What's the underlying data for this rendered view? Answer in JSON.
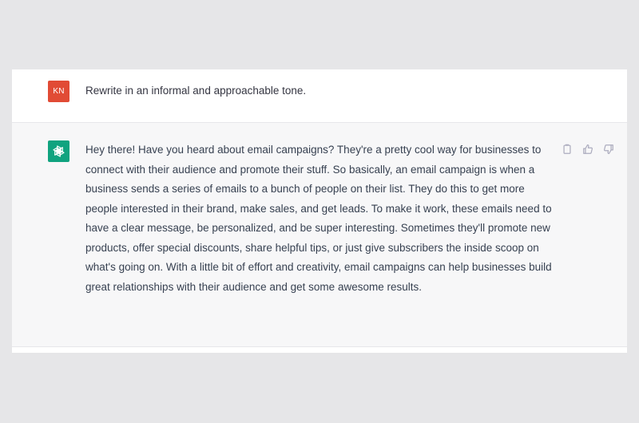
{
  "conversation": {
    "user_message": {
      "avatar_initials": "KN",
      "avatar_color": "#e14b35",
      "text": "Rewrite in an informal and approachable tone."
    },
    "assistant_message": {
      "avatar_icon": "openai-logo-icon",
      "avatar_color": "#10a37f",
      "text": "Hey there! Have you heard about email campaigns? They're a pretty cool way for businesses to connect with their audience and promote their stuff. So basically, an email campaign is when a business sends a series of emails to a bunch of people on their list. They do this to get more people interested in their brand, make sales, and get leads. To make it work, these emails need to have a clear message, be personalized, and be super interesting. Sometimes they'll promote new products, offer special discounts, share helpful tips, or just give subscribers the inside scoop on what's going on. With a little bit of effort and creativity, email campaigns can help businesses build great relationships with their audience and get some awesome results.",
      "actions": [
        {
          "icon": "copy-icon"
        },
        {
          "icon": "thumbs-up-icon"
        },
        {
          "icon": "thumbs-down-icon"
        }
      ]
    }
  }
}
